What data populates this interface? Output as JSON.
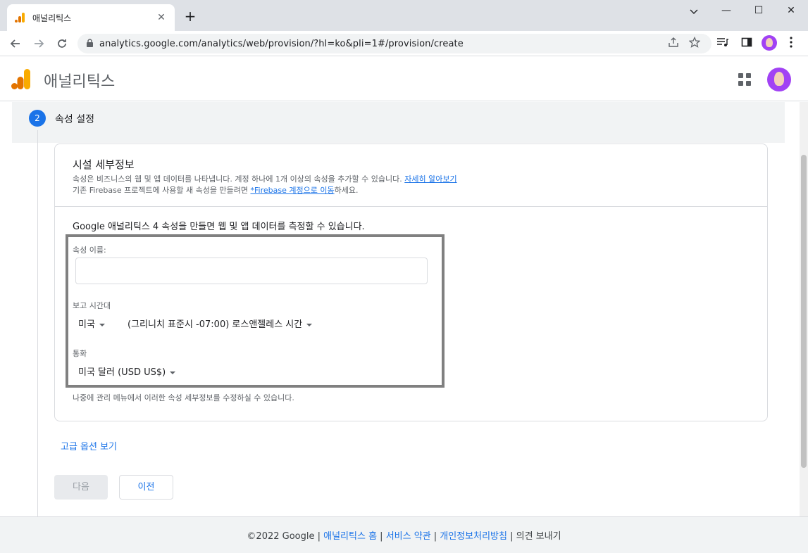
{
  "browser": {
    "tab_title": "애널리틱스",
    "tab_close": "✕",
    "new_tab": "+",
    "url": "analytics.google.com/analytics/web/provision/?hl=ko&pli=1#/provision/create",
    "window_controls": {
      "minimize": "—",
      "maximize": "☐",
      "close": "✕"
    }
  },
  "header": {
    "app_title": "애널리틱스",
    "brand_colors": {
      "orange": "#f9ab00",
      "dark_orange": "#e37400"
    }
  },
  "step": {
    "number": "2",
    "label": "속성 설정"
  },
  "card": {
    "title": "시설 세부정보",
    "desc1_text": "속성은 비즈니스의 웹 및 앱 데이터를 나타냅니다. 계정 하나에 1개 이상의 속성을 추가할 수 있습니다. ",
    "desc1_link": "자세히 알아보기",
    "desc2_prefix": "기존 Firebase 프로젝트에 사용할 새 속성을 만들려면 ",
    "desc2_link": "*Firebase 계정으로 이동",
    "desc2_suffix": "하세요.",
    "intro": "Google 애널리틱스 4 속성을 만들면 웹 및 앱 데이터를 측정할 수 있습니다.",
    "property_name_label": "속성 이름:",
    "property_name_value": "",
    "timezone_label": "보고 시간대",
    "country_value": "미국",
    "timezone_value": "(그리니치 표준시 -07:00) 로스앤젤레스 시간",
    "currency_label": "통화",
    "currency_value": "미국 달러 (USD US$)",
    "footnote": "나중에 관리 메뉴에서 이러한 속성 세부정보를 수정하실 수 있습니다."
  },
  "actions": {
    "advanced": "고급 옵션 보기",
    "next": "다음",
    "prev": "이전"
  },
  "footer": {
    "copyright": "©2022 Google",
    "sep": " | ",
    "home": "애널리틱스 홈",
    "terms": "서비스 약관",
    "privacy": "개인정보처리방침",
    "feedback": "의견 보내기"
  },
  "colors": {
    "accent": "#1a73e8",
    "highlight_border": "#808080",
    "step_band": "#f1f3f4"
  }
}
